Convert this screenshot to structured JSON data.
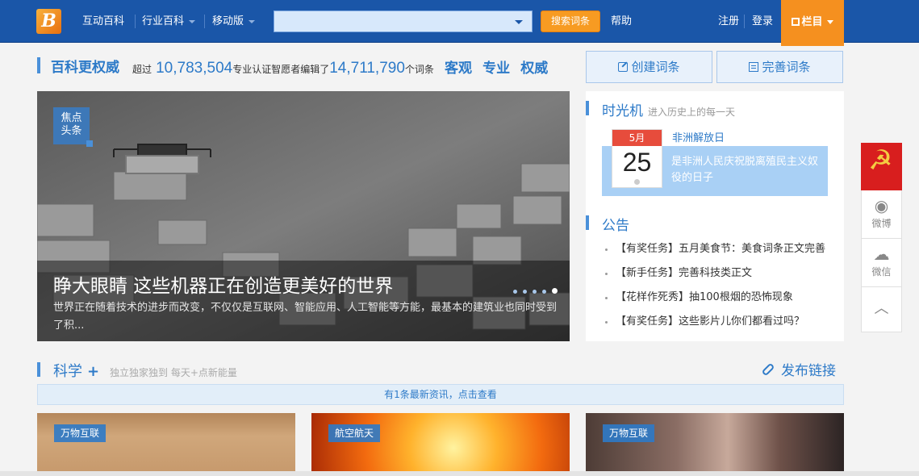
{
  "logo": {
    "glyph": "B"
  },
  "nav": {
    "items": [
      {
        "label": "互动百科",
        "has_caret": false
      },
      {
        "label": "行业百科",
        "has_caret": true
      },
      {
        "label": "移动版",
        "has_caret": true
      }
    ],
    "search": {
      "value": "",
      "placeholder": ""
    },
    "search_button": "搜索词条",
    "help": "帮助",
    "register": "注册",
    "login": "登录",
    "menu": "栏目"
  },
  "stats": {
    "title": "百科更权威",
    "prefix": "超过",
    "editors": "10,783,504",
    "editors_suffix": "专业认证智愿者编辑了",
    "entries": "14,711,790",
    "entries_suffix": "个词条",
    "keywords": [
      "客观",
      "专业",
      "权威"
    ]
  },
  "actions": {
    "create": "创建词条",
    "improve": "完善词条"
  },
  "carousel": {
    "badge_line1": "焦点",
    "badge_line2": "头条",
    "title": "睁大眼睛 这些机器正在创造更美好的世界",
    "description": "世界正在随着技术的进步而改变，不仅仅是互联网、智能应用、人工智能等方能，最基本的建筑业也同时受到了积...",
    "slide_count": 5,
    "active_slide": 5
  },
  "time_machine": {
    "title": "时光机",
    "subtitle": "进入历史上的每一天",
    "month": "5月",
    "day": "25",
    "event_name": "非洲解放日",
    "event_desc": "是非洲人民庆祝脱离殖民主义奴役的日子"
  },
  "notices": {
    "title": "公告",
    "items": [
      "【有奖任务】五月美食节：美食词条正文完善",
      "【新手任务】完善科技类正文",
      "【花样作死秀】抽100根烟的恐怖现象",
      "【有奖任务】这些影片儿你们都看过吗？"
    ]
  },
  "side": {
    "weibo": "微博",
    "weixin": "微信"
  },
  "science": {
    "title": "科学",
    "plus": "+",
    "subtitle": "独立独家独到  每天+点新能量",
    "publish": "发布链接",
    "news_bar": "有1条最新资讯，点击查看",
    "cards": [
      {
        "tag": "万物互联"
      },
      {
        "tag": "航空航天"
      },
      {
        "tag": "万物互联"
      }
    ]
  },
  "colors": {
    "nav_bg": "#1a56a8",
    "accent": "#2d7ac8",
    "orange": "#f5901f"
  }
}
